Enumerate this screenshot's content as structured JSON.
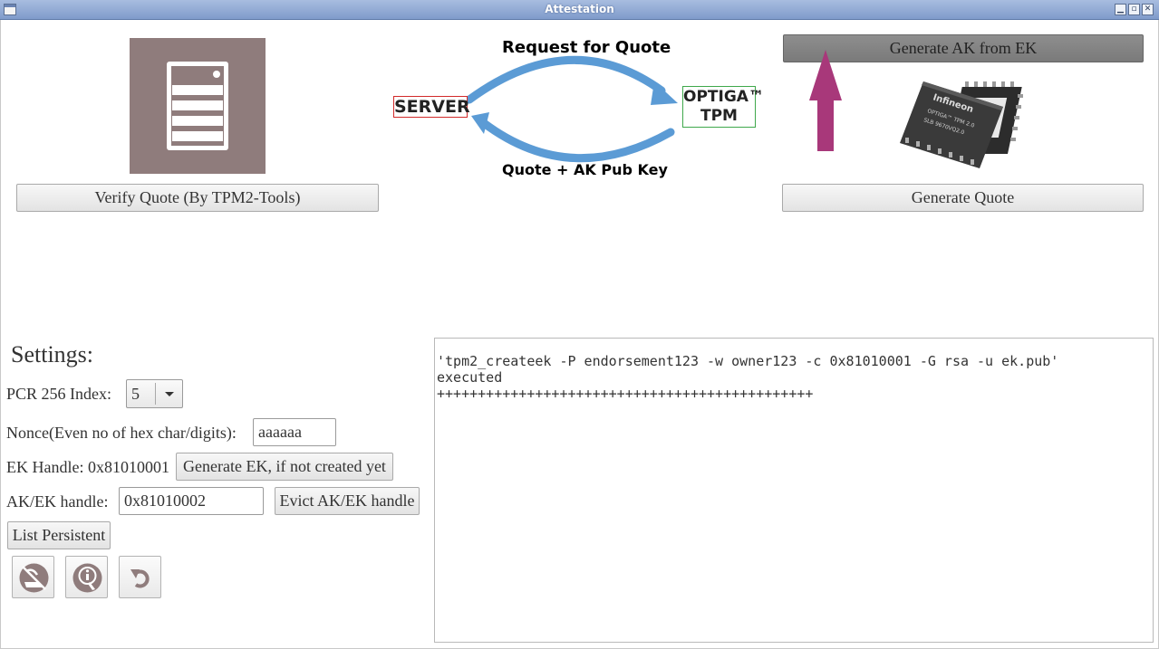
{
  "window": {
    "title": "Attestation"
  },
  "buttons": {
    "verify_quote": "Verify Quote (By TPM2-Tools)",
    "generate_ak": "Generate AK from EK",
    "generate_quote": "Generate Quote",
    "generate_ek": "Generate EK, if not created yet",
    "evict_handle": "Evict AK/EK handle",
    "list_persistent": "List Persistent"
  },
  "diagram": {
    "request_label": "Request for Quote",
    "response_label": "Quote + AK Pub Key",
    "server_label": "SERVER",
    "tpm_label_line1": "OPTIGA™",
    "tpm_label_line2": "TPM",
    "chip_brand": "Infineon",
    "chip_model": "OPTIGA™ TPM 2.0",
    "chip_part": "SLB 9670VQ2.0"
  },
  "settings": {
    "title": "Settings:",
    "pcr_label": "PCR 256 Index:",
    "pcr_value": "5",
    "nonce_label": "Nonce(Even no of hex char/digits):",
    "nonce_value": "aaaaaa",
    "ek_handle_label": "EK Handle: 0x81010001",
    "ak_ek_label": "AK/EK handle:",
    "ak_ek_value": "0x81010002"
  },
  "console": {
    "line1": "'tpm2_createek -P endorsement123 -w owner123 -c 0x81010001 -G rsa -u ek.pub'",
    "line2": "executed",
    "line3": "++++++++++++++++++++++++++++++++++++++++++++++"
  },
  "colors": {
    "tile": "#8f7c7c",
    "arrow": "#a8387a",
    "cycle_arrows": "#5b9bd5",
    "server_border": "#d22a2a",
    "tpm_border": "#3fa84b"
  },
  "icons": {
    "exit": "exit-icon",
    "info": "info-icon",
    "reset": "reset-icon"
  }
}
